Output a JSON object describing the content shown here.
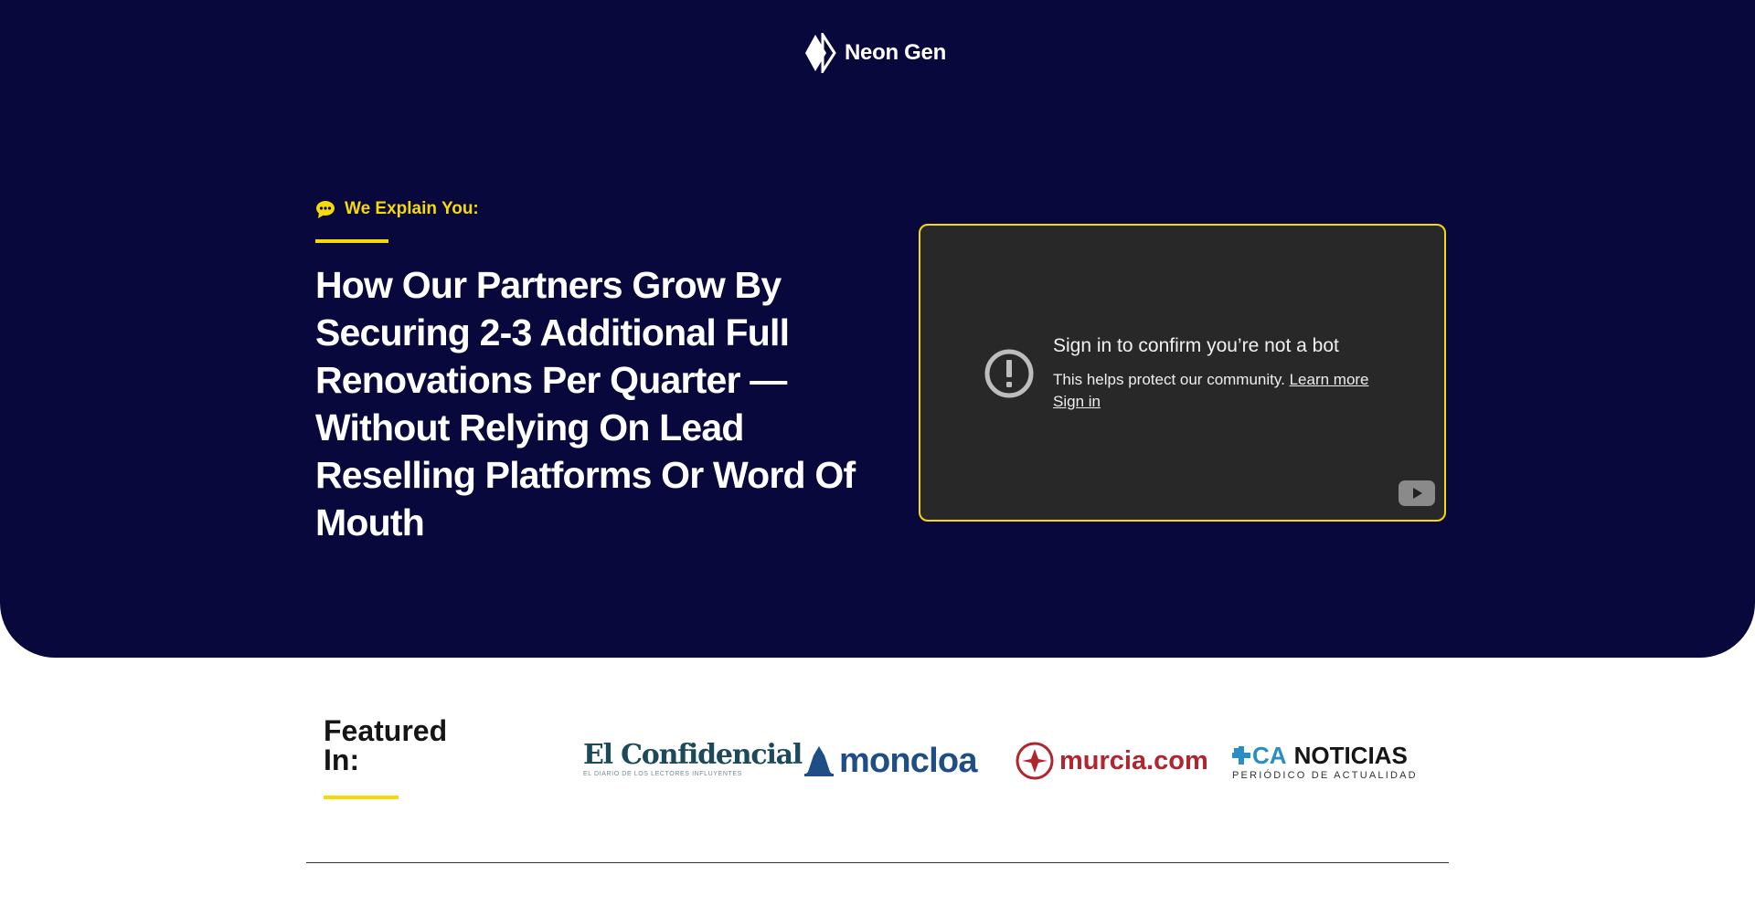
{
  "brand": {
    "name": "Neon Gen",
    "icon": "diamond-logo-icon"
  },
  "hero": {
    "eyebrow": "We Explain You:",
    "eyebrow_icon": "speech-bubble-icon",
    "headline": "How Our Partners Grow By Securing 2-3 Additional Full Renovations Per Quarter — Without Relying On Lead Reselling Platforms Or Word Of Mouth"
  },
  "video": {
    "title": "Sign in to confirm you’re not a bot",
    "body": "This helps protect our community.",
    "learn_more": "Learn more",
    "sign_in": "Sign in",
    "alert_icon": "exclamation-circle-icon",
    "play_icon": "youtube-play-icon"
  },
  "featured": {
    "title_line1": "Featured",
    "title_line2": "In:",
    "logos": [
      {
        "name": "El Confidencial",
        "tagline": "EL DIARIO DE LOS LECTORES INFLUYENTES"
      },
      {
        "name": "moncloa"
      },
      {
        "name": "murcia.com"
      },
      {
        "name": "NOTICIAS",
        "prefix": "CA",
        "tagline": "PERIÓDICO DE ACTUALIDAD"
      }
    ]
  },
  "colors": {
    "hero_bg": "#08083d",
    "accent": "#f5d90a",
    "video_bg": "#282828"
  }
}
